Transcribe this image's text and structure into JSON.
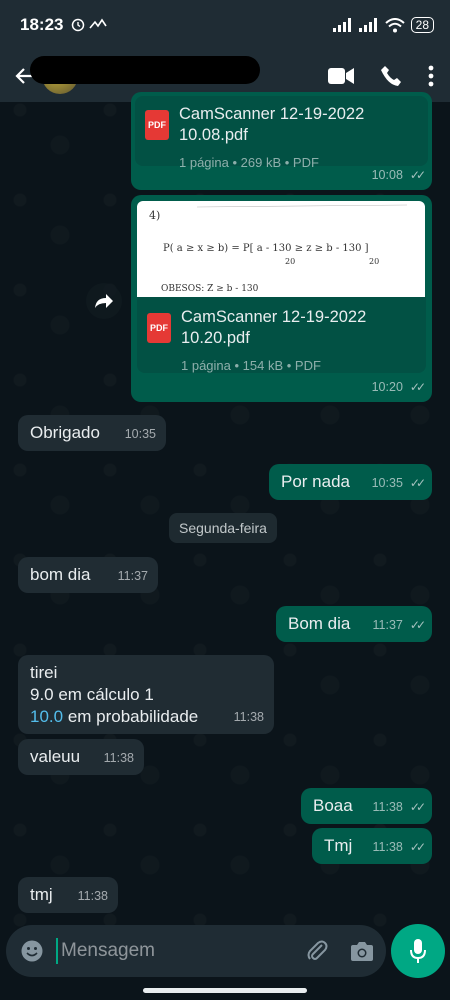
{
  "status_bar": {
    "time": "18:23",
    "battery": "28"
  },
  "header": {
    "contact_name": "",
    "back_icon": "arrow-left-icon",
    "video_icon": "video-call-icon",
    "call_icon": "phone-icon",
    "menu_icon": "more-vert-icon"
  },
  "messages": [
    {
      "type": "document",
      "direction": "out",
      "file_name": "CamScanner 12-19-2022 10.08.pdf",
      "file_name_line1": "CamScanner 12-19-2022",
      "file_name_line2": "10.08.pdf",
      "info": "1 página • 269 kB • PDF",
      "time": "10:08"
    },
    {
      "type": "document",
      "direction": "out",
      "file_name": "CamScanner 12-19-2022 10.20.pdf",
      "file_name_line1": "CamScanner 12-19-2022",
      "file_name_line2": "10.20.pdf",
      "info": "1 página • 154 kB • PDF",
      "time": "10:20",
      "preview_lines": [
        "4)",
        "P( a ≥ x ≥ b) = P[ a - 130 ≥ z ≥ b - 130 ]",
        "20",
        "20",
        "OBESOS:  Z ≥ b - 130"
      ]
    },
    {
      "type": "text",
      "direction": "in",
      "text": "Obrigado",
      "time": "10:35"
    },
    {
      "type": "text",
      "direction": "out",
      "text": "Por nada",
      "time": "10:35"
    },
    {
      "type": "day",
      "text": "Segunda-feira"
    },
    {
      "type": "text",
      "direction": "in",
      "text": "bom dia",
      "time": "11:37"
    },
    {
      "type": "text",
      "direction": "out",
      "text": "Bom dia",
      "time": "11:37"
    },
    {
      "type": "text",
      "direction": "in",
      "lines": [
        "tirei",
        "9.0 em cálculo 1"
      ],
      "line3_link": "10.0",
      "line3_rest": " em probabilidade",
      "time": "11:38"
    },
    {
      "type": "text",
      "direction": "in",
      "text": "valeuu",
      "time": "11:38"
    },
    {
      "type": "text",
      "direction": "out",
      "text": "Boaa",
      "time": "11:38"
    },
    {
      "type": "text",
      "direction": "out",
      "text": "Tmj",
      "time": "11:38"
    },
    {
      "type": "text",
      "direction": "in",
      "text": "tmj",
      "time": "11:38"
    }
  ],
  "input": {
    "placeholder": "Mensagem",
    "emoji_icon": "emoji-icon",
    "attach_icon": "paperclip-icon",
    "camera_icon": "camera-icon",
    "mic_icon": "microphone-icon"
  },
  "colors": {
    "background": "#0b141a",
    "bar": "#1f2c34",
    "incoming": "#202c33",
    "outgoing": "#005c4b",
    "accent": "#00a884",
    "link": "#53bdeb",
    "pdf": "#e53935"
  }
}
